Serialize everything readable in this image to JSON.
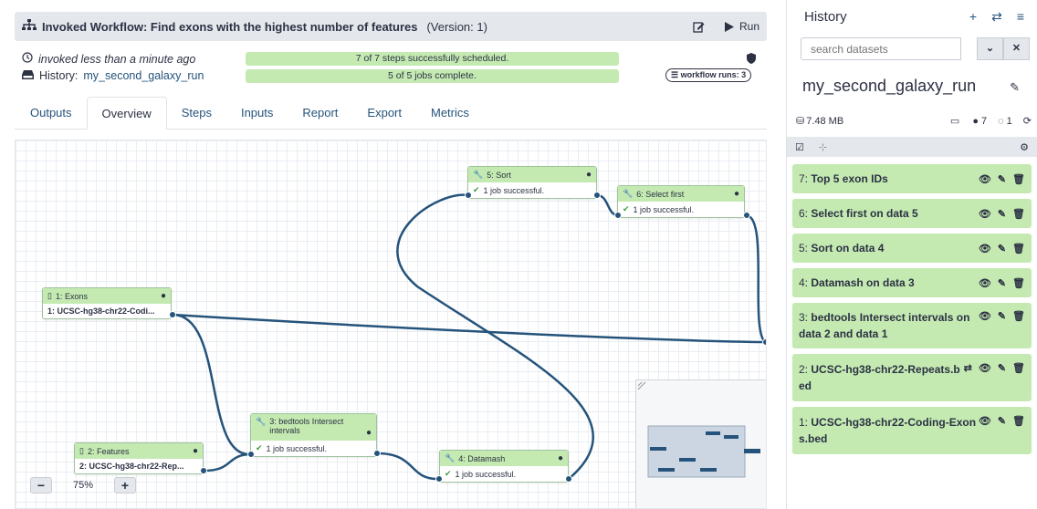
{
  "header": {
    "title": "Invoked Workflow: Find exons with the highest number of features",
    "version": "(Version: 1)",
    "run_label": "Run"
  },
  "invocation": {
    "time_text": "invoked less than a minute ago",
    "history_label": "History:",
    "history_link": "my_second_galaxy_run",
    "steps_status": "7 of 7 steps successfully scheduled.",
    "jobs_status": "5 of 5 jobs complete.",
    "runs_button": "workflow runs: 3"
  },
  "tabs": [
    "Outputs",
    "Overview",
    "Steps",
    "Inputs",
    "Report",
    "Export",
    "Metrics"
  ],
  "nodes": {
    "sort": {
      "title": "5: Sort",
      "status": "1 job successful."
    },
    "select": {
      "title": "6: Select first",
      "status": "1 job successful."
    },
    "exons": {
      "title": "1: Exons",
      "output": "1: UCSC-hg38-chr22-Codi..."
    },
    "bedtools": {
      "title": "3: bedtools Intersect intervals",
      "status": "1 job successful."
    },
    "features": {
      "title": "2: Features",
      "output": "2: UCSC-hg38-chr22-Rep..."
    },
    "datamash": {
      "title": "4: Datamash",
      "status": "1 job successful."
    }
  },
  "zoom": {
    "minus": "−",
    "plus": "+",
    "level": "75%"
  },
  "history": {
    "title": "History",
    "search_placeholder": "search datasets",
    "name": "my_second_galaxy_run",
    "size": "7.48 MB",
    "count_shown": "7",
    "count_hidden": "1",
    "datasets": [
      {
        "num": "7:",
        "name": "Top 5 exon IDs"
      },
      {
        "num": "6:",
        "name": "Select first on data 5"
      },
      {
        "num": "5:",
        "name": "Sort on data 4"
      },
      {
        "num": "4:",
        "name": "Datamash on data 3"
      },
      {
        "num": "3:",
        "name": "bedtools Intersect intervals on data 2 and data 1"
      },
      {
        "num": "2:",
        "name": "UCSC-hg38-chr22-Repeats.bed"
      },
      {
        "num": "1:",
        "name": "UCSC-hg38-chr22-Coding-Exons.bed"
      }
    ]
  },
  "colors": {
    "ok_green": "#c4eab2",
    "link_blue": "#25537b",
    "header_gray": "#e4e7ec"
  }
}
